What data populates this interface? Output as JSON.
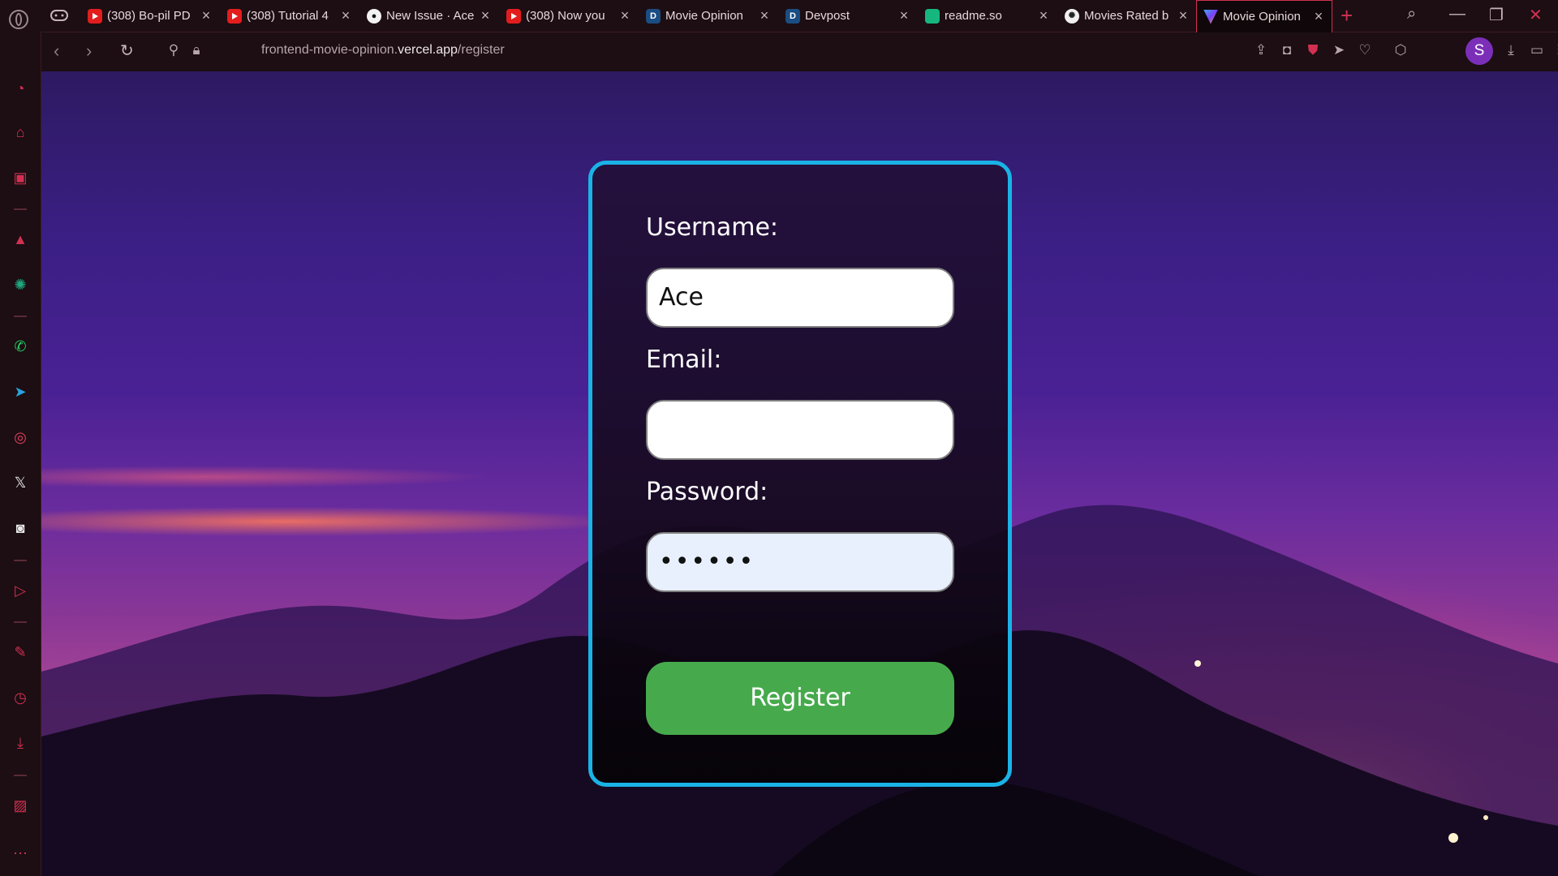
{
  "window": {
    "tabs": [
      {
        "title": "(308) Bo-pil PD",
        "favicon": "youtube-icon"
      },
      {
        "title": "(308) Tutorial 4",
        "favicon": "youtube-icon"
      },
      {
        "title": "New Issue · Ace",
        "favicon": "github-icon"
      },
      {
        "title": "(308) Now you",
        "favicon": "youtube-icon"
      },
      {
        "title": "Movie Opinion",
        "favicon": "devpost-icon"
      },
      {
        "title": "Devpost",
        "favicon": "devpost-icon"
      },
      {
        "title": "readme.so",
        "favicon": "readme-icon"
      },
      {
        "title": "Movies Rated b",
        "favicon": "chatgpt-icon"
      },
      {
        "title": "Movie Opinion",
        "favicon": "movie-opinion-icon",
        "active": true
      }
    ],
    "devpost_letter": "D",
    "new_tab": "+"
  },
  "address": {
    "url_prefix": "frontend-movie-opinion.",
    "url_domain": "vercel.app",
    "url_path": "/register"
  },
  "profile": {
    "initial": "S"
  },
  "form": {
    "username_label": "Username:",
    "username_value": "Ace",
    "email_label": "Email:",
    "email_value": "",
    "password_label": "Password:",
    "password_value": "••••••",
    "register_label": "Register"
  },
  "colors": {
    "card_border": "#1ab3e6",
    "register_button": "#46aa4c",
    "browser_accent": "#d23052"
  }
}
